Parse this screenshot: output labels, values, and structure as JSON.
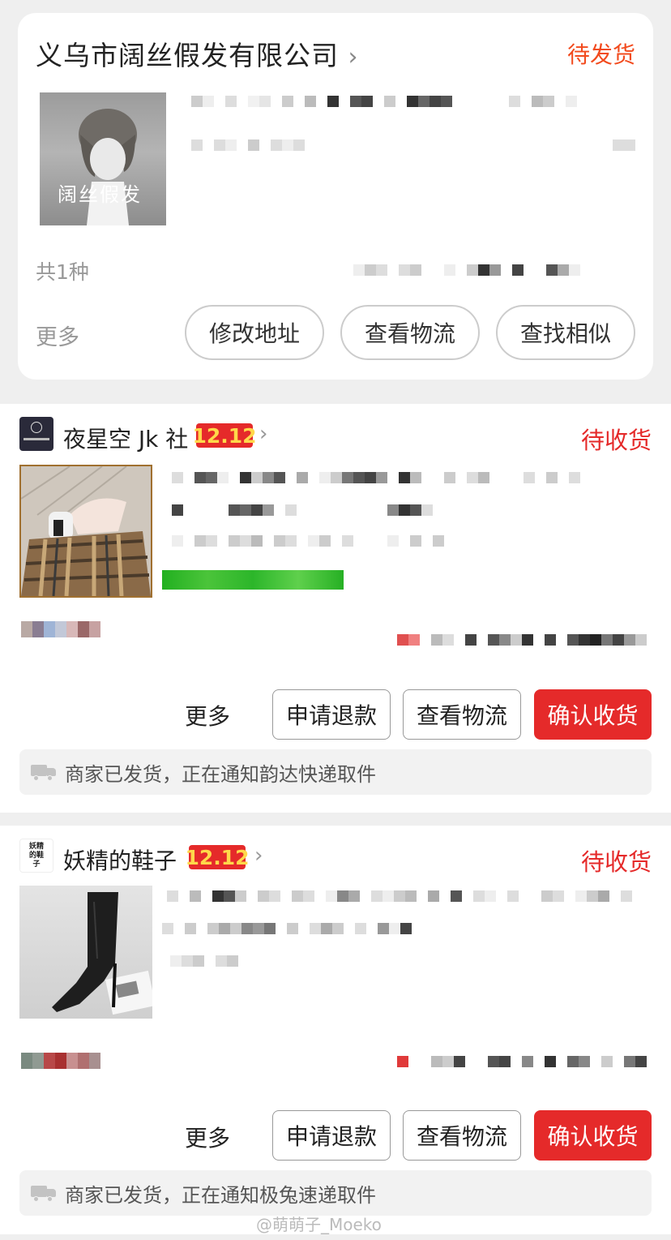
{
  "orders": [
    {
      "shop_name": "义乌市阔丝假发有限公司",
      "status": "待发货",
      "thumbnail_text": "阔丝假发",
      "item_count": "共1种",
      "more": "更多",
      "buttons": [
        "修改地址",
        "查看物流",
        "查找相似"
      ]
    },
    {
      "shop_name": "夜星空 Jk 社",
      "badge": "12.12",
      "status": "待收货",
      "more": "更多",
      "buttons": [
        "申请退款",
        "查看物流",
        "确认收货"
      ],
      "notice": "商家已发货，正在通知韵达快递取件"
    },
    {
      "shop_name": "妖精的鞋子",
      "logo_text": "妖精的鞋子",
      "badge": "12.12",
      "status": "待收货",
      "more": "更多",
      "buttons": [
        "申请退款",
        "查看物流",
        "确认收货"
      ],
      "notice": "商家已发货，正在通知极兔速递取件"
    }
  ],
  "watermark": "@萌萌子_Moeko",
  "colors": {
    "status_orange": "#f24b1e",
    "status_red": "#e52a2a",
    "confirm_button": "#e52a2a",
    "badge_text": "#ffd84a"
  }
}
